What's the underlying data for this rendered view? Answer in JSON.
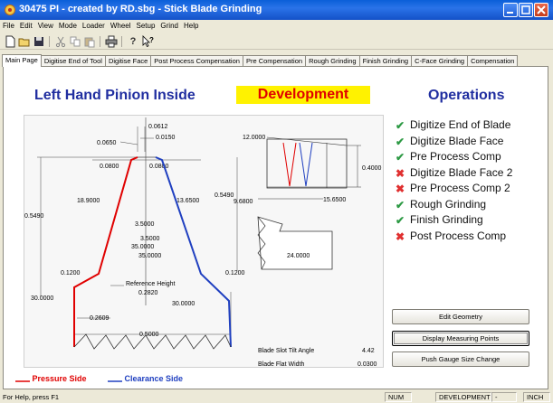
{
  "window": {
    "title": "30475 PI - created by RD.sbg - Stick Blade Grinding"
  },
  "menu": [
    "File",
    "Edit",
    "View",
    "Mode",
    "Loader",
    "Wheel",
    "Setup",
    "Grind",
    "Help"
  ],
  "toolbar": [
    "new-icon",
    "open-icon",
    "save-icon",
    "cut-icon",
    "copy-icon",
    "paste-icon",
    "print-icon",
    "help-icon",
    "context-help-icon"
  ],
  "tabs": [
    "Main Page",
    "Digitise End of Tool",
    "Digitise Face",
    "Post Process Compensation",
    "Pre Compensation",
    "Rough Grinding",
    "Finish Grinding",
    "C-Face Grinding",
    "Compensation"
  ],
  "header": {
    "part_name": "Left Hand Pinion Inside",
    "mode": "Development",
    "operations_title": "Operations"
  },
  "operations": [
    {
      "label": "Digitize End of Blade",
      "status": "done"
    },
    {
      "label": "Digitize Blade Face",
      "status": "done"
    },
    {
      "label": "Pre Process Comp",
      "status": "done"
    },
    {
      "label": "Digitize Blade Face 2",
      "status": "skipped"
    },
    {
      "label": "Pre Process Comp 2",
      "status": "skipped"
    },
    {
      "label": "Rough Grinding",
      "status": "done"
    },
    {
      "label": "Finish Grinding",
      "status": "done"
    },
    {
      "label": "Post Process Comp",
      "status": "skipped"
    }
  ],
  "drawing": {
    "dim_0612": "0.0612",
    "dim_0150": "0.0150",
    "dim_0650": "0.0650",
    "dim_0800_left": "0.0800",
    "dim_0800_right": "0.0800",
    "dim_0549_left": "0.5490",
    "dim_0549_right": "0.5490",
    "dim_189": "18.9000",
    "dim_1365": "13.6500",
    "dim_35a": "3.5000",
    "dim_35b": "3.5000",
    "dim_350a": "35.0000",
    "dim_350b": "35.0000",
    "dim_012_left": "0.1200",
    "dim_012_right": "0.1200",
    "ref_height_label": "Reference Height",
    "ref_height_value": "0.2820",
    "dim_300_left": "30.0000",
    "dim_300_right": "30.0000",
    "dim_02609": "0.2609",
    "dim_05000": "0.5000",
    "dim_120": "12.0000",
    "dim_04000": "0.4000",
    "dim_9680": "9.6800",
    "dim_1565": "15.6500",
    "dim_240": "24.0000"
  },
  "params": [
    {
      "label": "Blade Slot Tilt Angle",
      "value": "4.42"
    },
    {
      "label": "Blade Flat Width",
      "value": "0.0300"
    }
  ],
  "buttons": {
    "edit_geometry": "Edit Geometry",
    "display_measuring_points": "Display Measuring Points",
    "push_gauge": "Push Gauge Size Change"
  },
  "legend": {
    "pressure": "Pressure Side",
    "clearance": "Clearance Side"
  },
  "colors": {
    "pressure": "#e00000",
    "clearance": "#2040c0",
    "ok": "#2e9a45",
    "bad": "#e03030"
  },
  "status": {
    "message": "For Help, press F1",
    "num": "NUM",
    "mode": "DEVELOPMENT",
    "sep": "-",
    "units": "INCH"
  }
}
